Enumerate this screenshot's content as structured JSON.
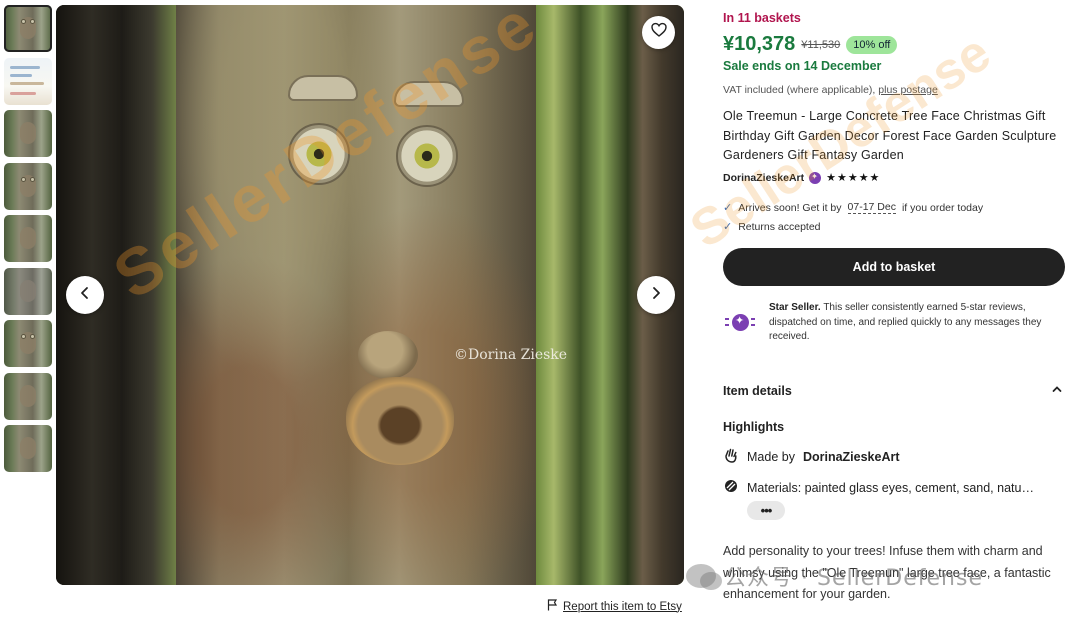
{
  "gallery": {
    "thumbnails": [
      "thumb-1",
      "thumb-2",
      "thumb-3",
      "thumb-4",
      "thumb-5",
      "thumb-6",
      "thumb-7",
      "thumb-8",
      "thumb-9"
    ],
    "image_watermark": "©Dorina Zieske",
    "report_label": "Report this item to Etsy"
  },
  "product": {
    "baskets": "In 11 baskets",
    "price": "¥10,378",
    "old_price": "¥11,530",
    "discount": "10% off",
    "sale_ends": "Sale ends on 14 December",
    "vat_text": "VAT included (where applicable),",
    "vat_link": "plus postage",
    "title": "Ole Treemun - Large Concrete Tree Face Christmas Gift Birthday Gift Garden Decor Forest Face Garden Sculpture Gardeners Gift Fantasy Garden",
    "seller": "DorinaZieskeArt",
    "stars": "★★★★★",
    "arrives_prefix": "Arrives soon! Get it by",
    "arrives_date": "07-17 Dec",
    "arrives_suffix": "if you order today",
    "returns": "Returns accepted",
    "add_button": "Add to basket",
    "star_seller_title": "Star Seller.",
    "star_seller_text": "This seller consistently earned 5-star reviews, dispatched on time, and replied quickly to any messages they received."
  },
  "details": {
    "heading": "Item details",
    "highlights_heading": "Highlights",
    "made_by_prefix": "Made by",
    "made_by_name": "DorinaZieskeArt",
    "materials": "Materials: painted glass eyes, cement, sand, natu…",
    "more_label": "•••",
    "description": "Add personality to your trees! Infuse them with charm and whimsy using the \"Ole Treemun\" large tree face, a fantastic enhancement for your garden."
  },
  "overlay": {
    "diagonal_watermark": "SellerDefense",
    "wechat_label": "公众号 · SellerDefense"
  },
  "colors": {
    "price_green": "#1a7a3e",
    "baskets_red": "#b1154e",
    "badge_purple": "#7b3fb2",
    "discount_bg": "#9ee59a"
  }
}
